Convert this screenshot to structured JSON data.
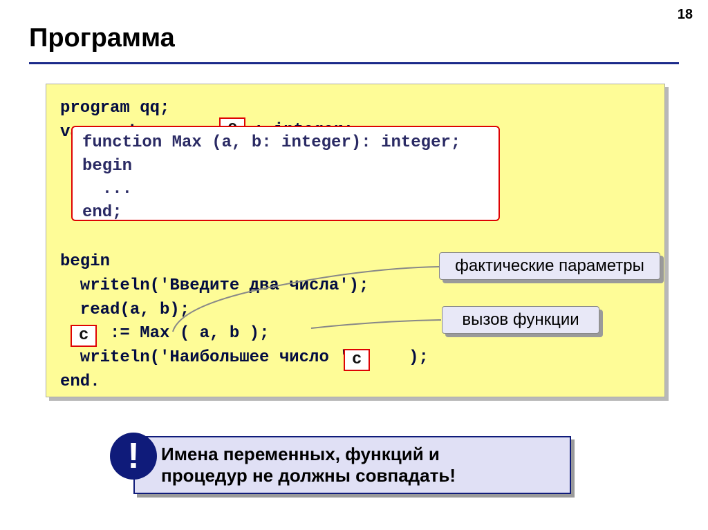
{
  "page_number": "18",
  "title": "Программа",
  "code": {
    "line1": "program qq;",
    "line2_pre": "var a, b,",
    "c_label": "c",
    "line2_post": ": integer;",
    "func": {
      "l1": "function Max (a, b: integer): integer;",
      "l2": "begin",
      "l3": "  ...",
      "l4": "end;"
    },
    "begin": "begin",
    "wl1": "  writeln('Введите два числа');",
    "rd": "  read(a, b);",
    "assign_prefix": "  ",
    "assign_suffix": " := Max ( a, b );",
    "wl2_pre": "  writeln('Наибольшее число ',",
    "wl2_post": " );",
    "end": "end."
  },
  "labels": {
    "actual_params": "фактические параметры",
    "func_call": "вызов функции"
  },
  "warning": {
    "exclaim": "!",
    "text_l1": "Имена переменных, функций и",
    "text_l2": "процедур не должны совпадать!"
  }
}
